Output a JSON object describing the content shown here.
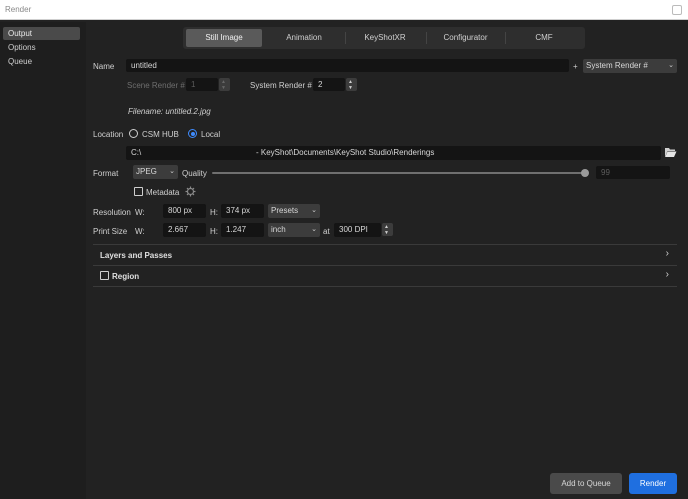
{
  "window": {
    "title": "Render"
  },
  "sidebar": {
    "items": [
      {
        "label": "Output",
        "active": true
      },
      {
        "label": "Options",
        "active": false
      },
      {
        "label": "Queue",
        "active": false
      }
    ]
  },
  "tabs": [
    {
      "label": "Still Image",
      "active": true
    },
    {
      "label": "Animation",
      "active": false
    },
    {
      "label": "KeyShotXR",
      "active": false
    },
    {
      "label": "Configurator",
      "active": false
    },
    {
      "label": "CMF",
      "active": false
    }
  ],
  "name": {
    "label": "Name",
    "value": "untitled",
    "plus": "+",
    "suffix_option": "System Render #",
    "scene_render_label": "Scene Render #",
    "scene_render_value": "1",
    "system_render_label": "System Render #",
    "system_render_value": "2",
    "filename": "Filename: untitled.2.jpg"
  },
  "location": {
    "label": "Location",
    "option_csm": "CSM HUB",
    "option_local": "Local",
    "selected": "Local",
    "path_drive": "C:\\",
    "path_rest": "- KeyShot\\Documents\\KeyShot Studio\\Renderings"
  },
  "format": {
    "label": "Format",
    "value": "JPEG",
    "quality_label": "Quality",
    "quality_value": "99",
    "metadata_label": "Metadata"
  },
  "resolution": {
    "label": "Resolution",
    "w_label": "W:",
    "w_value": "800 px",
    "h_label": "H:",
    "h_value": "374 px",
    "presets_label": "Presets"
  },
  "print_size": {
    "label": "Print Size",
    "w_label": "W:",
    "w_value": "2.667",
    "h_label": "H:",
    "h_value": "1.247",
    "unit": "inch",
    "at_label": "at",
    "dpi_value": "300 DPI"
  },
  "sections": [
    {
      "label": "Layers and Passes",
      "has_checkbox": false
    },
    {
      "label": "Region",
      "has_checkbox": true
    }
  ],
  "footer": {
    "add_to_queue": "Add to Queue",
    "render": "Render"
  },
  "colors": {
    "accent": "#1f6fe0",
    "background": "#222222",
    "sidebar": "#1e1e1e"
  }
}
